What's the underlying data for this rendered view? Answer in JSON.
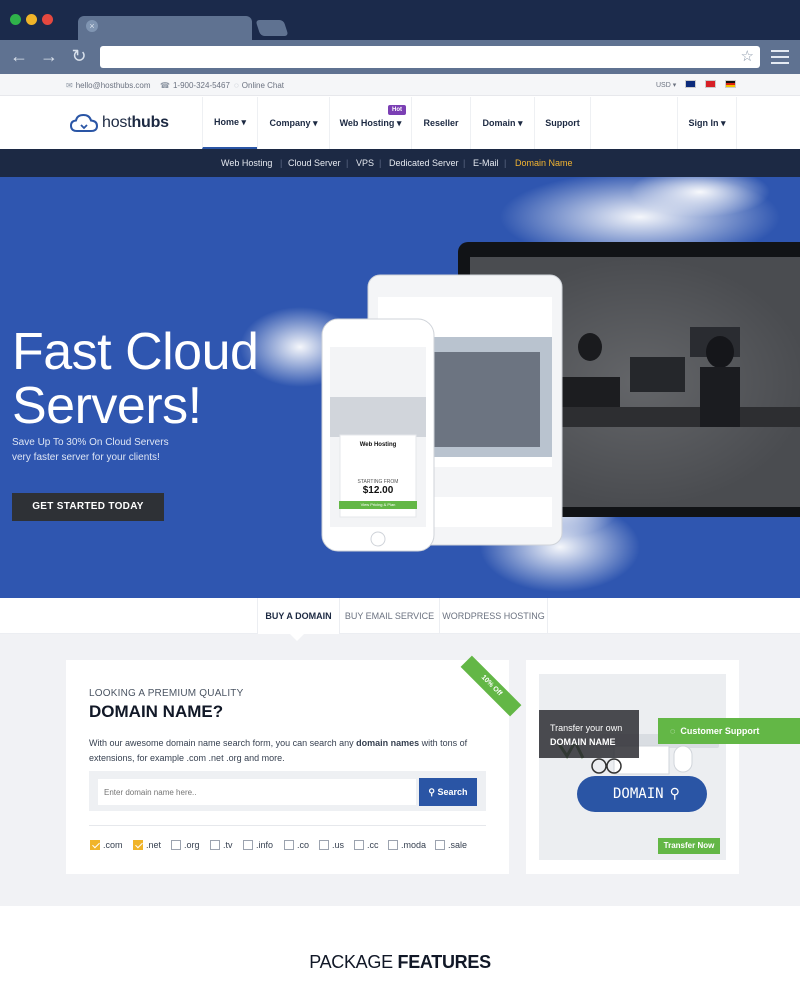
{
  "browser": {
    "url": ""
  },
  "topbar": {
    "email": "hello@hosthubs.com",
    "phone": "1-900-324-5467",
    "chat": "Online Chat",
    "currency": "USD"
  },
  "logo": {
    "part1": "host",
    "part2": "hubs"
  },
  "nav": {
    "home": "Home",
    "company": "Company",
    "web_hosting": "Web Hosting",
    "hot": "Hot",
    "reseller": "Reseller",
    "domain": "Domain",
    "support": "Support",
    "sign_in": "Sign In"
  },
  "subnav": {
    "items": [
      "Web Hosting",
      "Cloud Server",
      "VPS",
      "Dedicated Server",
      "E-Mail",
      "Domain Name"
    ]
  },
  "hero": {
    "title_line1": "Fast Cloud",
    "title_line2": "Servers!",
    "subtitle_line1": "Save Up To 30% On Cloud Servers",
    "subtitle_line2": "very faster server for your clients!",
    "cta": "GET STARTED TODAY",
    "phone_card_title": "Web Hosting",
    "phone_card_starting": "STARTING FROM",
    "phone_card_price": "$12.00",
    "phone_card_btn": "View Pricing & Plan"
  },
  "domain_tabs": [
    "BUY A DOMAIN",
    "BUY EMAIL SERVICE",
    "WORDPRESS HOSTING"
  ],
  "domain_search": {
    "ribbon": "10% Off",
    "eyebrow": "LOOKING A PREMIUM QUALITY",
    "title": "DOMAIN NAME?",
    "desc_pre": "With our awesome domain name search form, you can search any ",
    "desc_bold": "domain names",
    "desc_post": " with tons of extensions, for example .com .net .org and more.",
    "placeholder": "Enter domain name here..",
    "button": "Search",
    "tlds": [
      {
        "label": ".com",
        "checked": true
      },
      {
        "label": ".net",
        "checked": true
      },
      {
        "label": ".org",
        "checked": false
      },
      {
        "label": ".tv",
        "checked": false
      },
      {
        "label": ".info",
        "checked": false
      },
      {
        "label": ".co",
        "checked": false
      },
      {
        "label": ".us",
        "checked": false
      },
      {
        "label": ".cc",
        "checked": false
      },
      {
        "label": ".moda",
        "checked": false
      },
      {
        "label": ".sale",
        "checked": false
      }
    ]
  },
  "promo": {
    "line1": "Transfer your own",
    "line2": "DOMAIN NAME",
    "support": "Customer Support",
    "bubble": "DOMAIN",
    "transfer": "Transfer Now"
  },
  "features": {
    "title_light": "PACKAGE ",
    "title_bold": "FEATURES"
  },
  "colors": {
    "primary": "#2a55a5",
    "navy": "#1c2944",
    "accent_yellow": "#f4b531",
    "green": "#63b746"
  }
}
